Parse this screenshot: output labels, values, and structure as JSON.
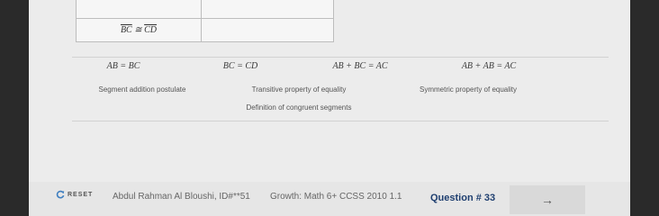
{
  "table": {
    "rows": [
      {
        "statement": "",
        "reason": ""
      },
      {
        "statement": "BC ≅ CD",
        "reason": ""
      }
    ]
  },
  "options": {
    "statements": [
      "AB = BC",
      "BC = CD",
      "AB + BC = AC",
      "AB + AB = AC"
    ],
    "reasons": [
      "Segment addition postulate",
      "Transitive property of equality",
      "Symmetric property of equality",
      "Definition of congruent segments"
    ]
  },
  "footer": {
    "reset_label": "RESET",
    "student": "Abdul Rahman Al Bloushi, ID#**51",
    "course": "Growth: Math 6+ CCSS 2010 1.1",
    "question": "Question # 33",
    "next_arrow": "→"
  }
}
